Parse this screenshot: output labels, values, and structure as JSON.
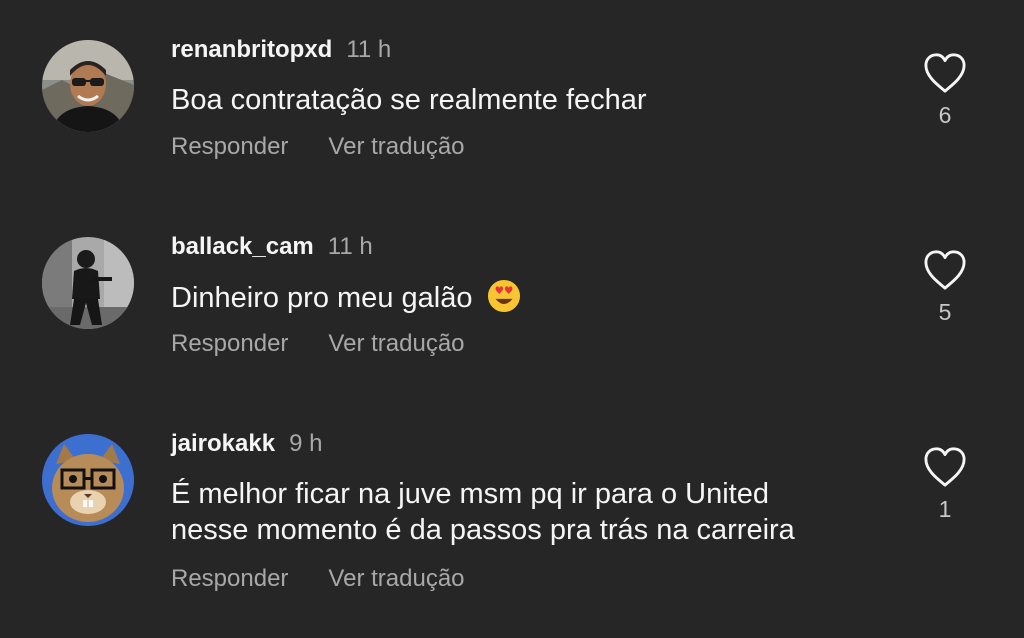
{
  "colors": {
    "background": "#262626",
    "primary_text": "#f5f5f5",
    "secondary_text": "#a8a8a8"
  },
  "comments": [
    {
      "username": "renanbritopxd",
      "time": "11 h",
      "text": "Boa contratação se realmente fechar",
      "reply_label": "Responder",
      "translate_label": "Ver tradução",
      "likes": "6",
      "avatar_icon": "avatar-man-sunglasses"
    },
    {
      "username": "ballack_cam",
      "time": "11 h",
      "text": "Dinheiro pro meu galão",
      "emoji_icon": "heart-eyes-emoji",
      "reply_label": "Responder",
      "translate_label": "Ver tradução",
      "likes": "5",
      "avatar_icon": "avatar-person-dark"
    },
    {
      "username": "jairokakk",
      "time": "9 h",
      "text_line1": "É melhor ficar na juve msm pq ir para o United",
      "text_line2": "nesse momento é da passos pra trás na carreira",
      "reply_label": "Responder",
      "translate_label": "Ver tradução",
      "likes": "1",
      "avatar_icon": "avatar-cat-glasses"
    }
  ]
}
